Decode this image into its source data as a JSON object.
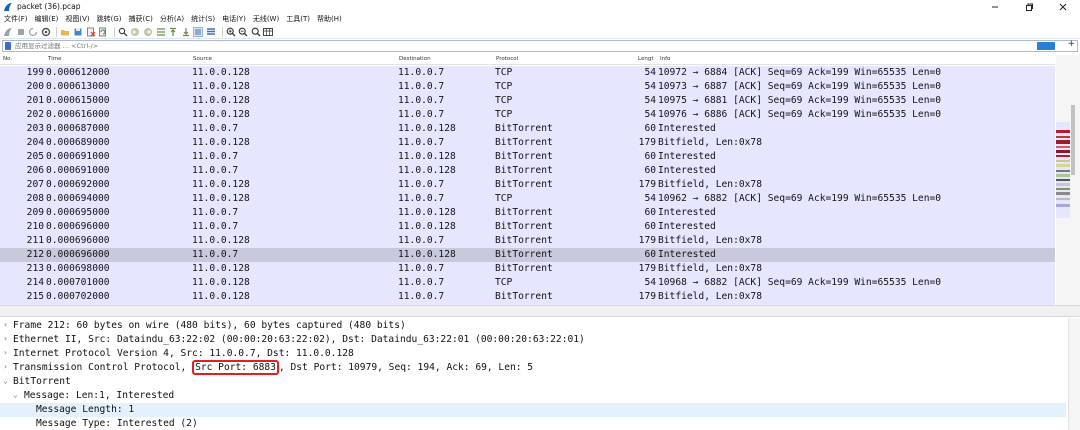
{
  "window": {
    "title": "packet (36).pcap"
  },
  "menu": [
    "文件(F)",
    "编辑(E)",
    "视图(V)",
    "跳转(G)",
    "捕获(C)",
    "分析(A)",
    "统计(S)",
    "电话(Y)",
    "无线(W)",
    "工具(T)",
    "帮助(H)"
  ],
  "filter": {
    "placeholder": "应用显示过滤器 … <Ctrl-/>"
  },
  "columns": {
    "no": "No.",
    "time": "Time",
    "source": "Source",
    "destination": "Destination",
    "protocol": "Protocol",
    "length": "Lengt",
    "info": "Info"
  },
  "packets": [
    {
      "no": "199",
      "time": "0.000612000",
      "src": "11.0.0.128",
      "dst": "11.0.0.7",
      "proto": "TCP",
      "len": "54",
      "info": "10972 → 6884 [ACK] Seq=69 Ack=199 Win=65535 Len=0"
    },
    {
      "no": "200",
      "time": "0.000613000",
      "src": "11.0.0.128",
      "dst": "11.0.0.7",
      "proto": "TCP",
      "len": "54",
      "info": "10973 → 6887 [ACK] Seq=69 Ack=199 Win=65535 Len=0"
    },
    {
      "no": "201",
      "time": "0.000615000",
      "src": "11.0.0.128",
      "dst": "11.0.0.7",
      "proto": "TCP",
      "len": "54",
      "info": "10975 → 6881 [ACK] Seq=69 Ack=199 Win=65535 Len=0"
    },
    {
      "no": "202",
      "time": "0.000616000",
      "src": "11.0.0.128",
      "dst": "11.0.0.7",
      "proto": "TCP",
      "len": "54",
      "info": "10976 → 6886 [ACK] Seq=69 Ack=199 Win=65535 Len=0"
    },
    {
      "no": "203",
      "time": "0.000687000",
      "src": "11.0.0.7",
      "dst": "11.0.0.128",
      "proto": "BitTorrent",
      "len": "60",
      "info": "Interested"
    },
    {
      "no": "204",
      "time": "0.000689000",
      "src": "11.0.0.128",
      "dst": "11.0.0.7",
      "proto": "BitTorrent",
      "len": "179",
      "info": "Bitfield, Len:0x78"
    },
    {
      "no": "205",
      "time": "0.000691000",
      "src": "11.0.0.7",
      "dst": "11.0.0.128",
      "proto": "BitTorrent",
      "len": "60",
      "info": "Interested"
    },
    {
      "no": "206",
      "time": "0.000691000",
      "src": "11.0.0.7",
      "dst": "11.0.0.128",
      "proto": "BitTorrent",
      "len": "60",
      "info": "Interested"
    },
    {
      "no": "207",
      "time": "0.000692000",
      "src": "11.0.0.128",
      "dst": "11.0.0.7",
      "proto": "BitTorrent",
      "len": "179",
      "info": "Bitfield, Len:0x78"
    },
    {
      "no": "208",
      "time": "0.000694000",
      "src": "11.0.0.128",
      "dst": "11.0.0.7",
      "proto": "TCP",
      "len": "54",
      "info": "10962 → 6882 [ACK] Seq=69 Ack=199 Win=65535 Len=0"
    },
    {
      "no": "209",
      "time": "0.000695000",
      "src": "11.0.0.7",
      "dst": "11.0.0.128",
      "proto": "BitTorrent",
      "len": "60",
      "info": "Interested"
    },
    {
      "no": "210",
      "time": "0.000696000",
      "src": "11.0.0.7",
      "dst": "11.0.0.128",
      "proto": "BitTorrent",
      "len": "60",
      "info": "Interested"
    },
    {
      "no": "211",
      "time": "0.000696000",
      "src": "11.0.0.128",
      "dst": "11.0.0.7",
      "proto": "BitTorrent",
      "len": "179",
      "info": "Bitfield, Len:0x78"
    },
    {
      "no": "212",
      "time": "0.000696000",
      "src": "11.0.0.7",
      "dst": "11.0.0.128",
      "proto": "BitTorrent",
      "len": "60",
      "info": "Interested"
    },
    {
      "no": "213",
      "time": "0.000698000",
      "src": "11.0.0.128",
      "dst": "11.0.0.7",
      "proto": "BitTorrent",
      "len": "179",
      "info": "Bitfield, Len:0x78"
    },
    {
      "no": "214",
      "time": "0.000701000",
      "src": "11.0.0.128",
      "dst": "11.0.0.7",
      "proto": "TCP",
      "len": "54",
      "info": "10968 → 6882 [ACK] Seq=69 Ack=199 Win=65535 Len=0"
    },
    {
      "no": "215",
      "time": "0.000702000",
      "src": "11.0.0.128",
      "dst": "11.0.0.7",
      "proto": "BitTorrent",
      "len": "179",
      "info": "Bitfield, Len:0x78"
    }
  ],
  "selected_packet": "212",
  "details": {
    "frame": "Frame 212: 60 bytes on wire (480 bits), 60 bytes captured (480 bits)",
    "ethernet": "Ethernet II, Src: Dataindu_63:22:02 (00:00:20:63:22:02), Dst: Dataindu_63:22:01 (00:00:20:63:22:01)",
    "ip": "Internet Protocol Version 4, Src: 11.0.0.7, Dst: 11.0.0.128",
    "tcp_prefix": "Transmission Control Protocol, ",
    "tcp_src_port": "Src Port: 6883",
    "tcp_suffix": ", Dst Port: 10979, Seq: 194, Ack: 69, Len: 5",
    "bittorrent": "BitTorrent",
    "message": "Message: Len:1, Interested",
    "message_length": "Message Length: 1",
    "message_type": "Message Type: Interested (2)"
  },
  "colors": {
    "row_bg": "#e7e6ff",
    "selected_row": "#c9c9dd",
    "highlight_box": "#e02020",
    "detail_highlight": "#e4f0fc"
  }
}
